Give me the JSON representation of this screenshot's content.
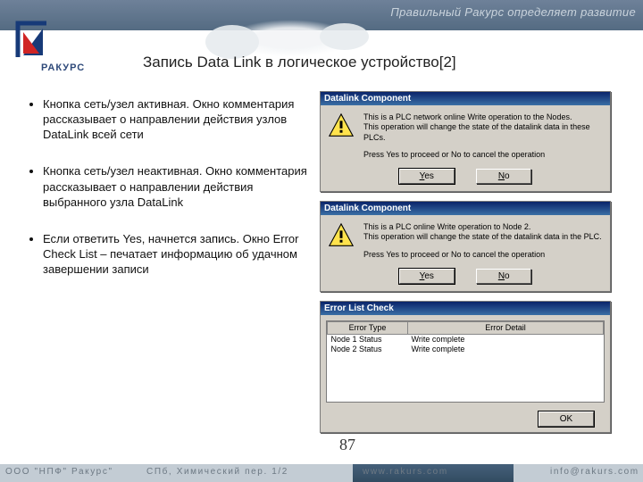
{
  "header": {
    "slogan": "Правильный Ракурс определяет развитие"
  },
  "logo": {
    "brand": "РАКУРС"
  },
  "slide": {
    "title": "Запись Data Link в логическое устройство[2]"
  },
  "bullets": {
    "b1": "Кнопка сеть/узел активная. Окно комментария рассказывает о направлении действия узлов  DataLink всей сети",
    "b2": "Кнопка сеть/узел неактивная. Окно комментария рассказывает о направлении действия выбранного узла DataLink",
    "b3": "Если ответить Yes, начнется запись. Окно Error Check List – печатает информацию об удачном завершении записи"
  },
  "dlg1": {
    "title": "Datalink Component",
    "line1": "This is a PLC network online Write operation to the Nodes.",
    "line2": "This operation will change the state of the datalink data in these PLCs.",
    "line3": "Press Yes to proceed or No to cancel the operation",
    "yes": "Yes",
    "no": "No"
  },
  "dlg2": {
    "title": "Datalink Component",
    "line1": "This is a PLC online Write operation to Node 2.",
    "line2": "This operation will change the state of the datalink data in the PLC.",
    "line3": "Press Yes to proceed or No to cancel the operation",
    "yes": "Yes",
    "no": "No"
  },
  "elc": {
    "title": "Error List Check",
    "col1": "Error Type",
    "col2": "Error Detail",
    "rows": [
      {
        "type": "Node 1 Status",
        "detail": "Write complete"
      },
      {
        "type": "Node 2 Status",
        "detail": "Write complete"
      }
    ],
    "ok": "OK"
  },
  "pagenum": "87",
  "footer": {
    "org": "ООО \"НПФ\" Ракурс\"",
    "addr": "СПб, Химический пер. 1/2",
    "url": "www.rakurs.com",
    "mail": "info@rakurs.com"
  }
}
